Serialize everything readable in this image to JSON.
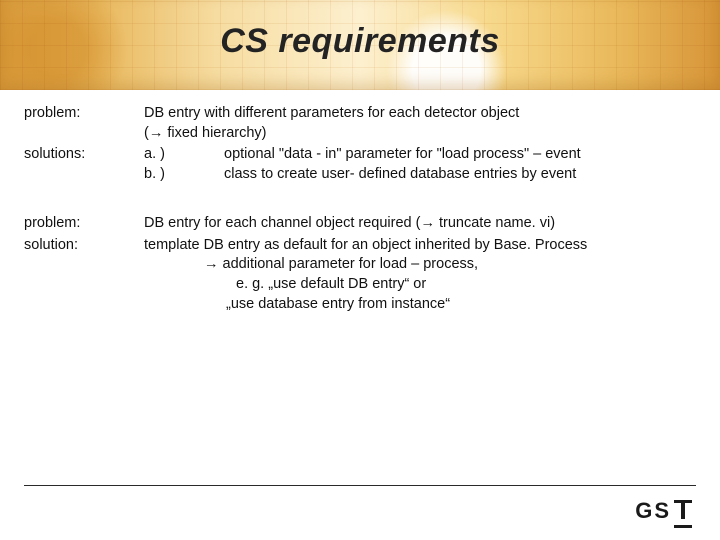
{
  "title": "CS requirements",
  "block1": {
    "label_problem": "problem:",
    "label_solutions": "solutions:",
    "problem_l1": "DB entry with different parameters for each detector object",
    "problem_l2": "(→ fixed hierarchy)",
    "a_tag": "a. )",
    "a_text": "optional \"data - in\" parameter for \"load process\" – event",
    "b_tag": "b. )",
    "b_text": "class to create user- defined database entries by event"
  },
  "block2": {
    "label_problem": "problem:",
    "label_solution": "solution:",
    "problem_text": "DB entry for each channel object required (→ truncate name. vi)",
    "solution_l1": "template DB entry as default for an object inherited by Base. Process",
    "solution_l2": "→   additional parameter for load – process,",
    "solution_l3": "e. g. „use default DB entry“ or",
    "solution_l4": "„use database entry from instance“"
  },
  "logo": {
    "text": "GS"
  }
}
